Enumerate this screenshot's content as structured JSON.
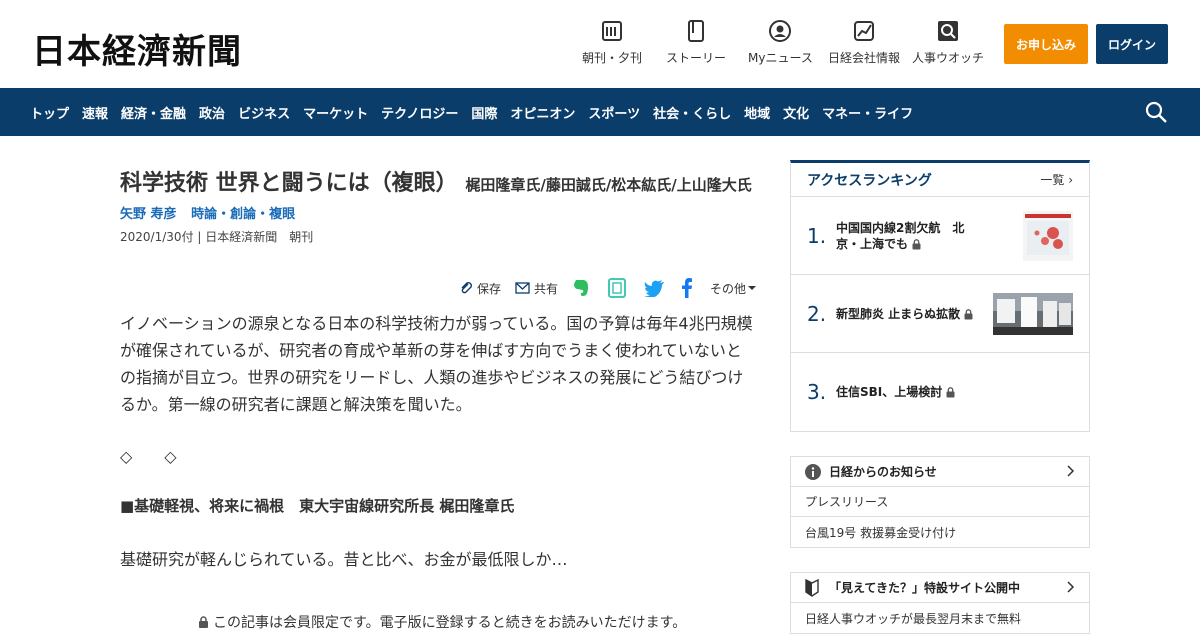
{
  "header": {
    "logo": "日本経濟新聞",
    "nav": [
      {
        "label": "朝刊・夕刊",
        "icon": "newspaper-icon"
      },
      {
        "label": "ストーリー",
        "icon": "book-icon"
      },
      {
        "label": "Myニュース",
        "icon": "user-icon"
      },
      {
        "label": "日経会社情報",
        "icon": "chart-icon"
      },
      {
        "label": "人事ウオッチ",
        "icon": "magnifier-icon"
      }
    ],
    "apply_label": "お申し込み",
    "login_label": "ログイン"
  },
  "navbar": {
    "items": [
      "トップ",
      "速報",
      "経済・金融",
      "政治",
      "ビジネス",
      "マーケット",
      "テクノロジー",
      "国際",
      "オピニオン",
      "スポーツ",
      "社会・くらし",
      "地域",
      "文化",
      "マネー・ライフ"
    ]
  },
  "article": {
    "title": "科学技術 世界と闘うには（複眼）",
    "title_names": "梶田隆章氏/藤田誠氏/松本紘氏/上山隆大氏",
    "author": "矢野 寿彦",
    "category": "時論・創論・複眼",
    "date": "2020/1/30付",
    "source": "日本経済新聞　朝刊",
    "tools": {
      "save": "保存",
      "share": "共有",
      "other": "その他"
    },
    "lead": "イノベーションの源泉となる日本の科学技術力が弱っている。国の予算は毎年4兆円規模が確保されているが、研究者の育成や革新の芽を伸ばす方向でうまく使われていないとの指摘が目立つ。世界の研究をリードし、人類の進歩やビジネスの発展にどう結びつけるか。第一線の研究者に課題と解決策を聞いた。",
    "diamonds": "◇　　◇",
    "subhead": "■基礎軽視、将来に禍根　東大宇宙線研究所長 梶田隆章氏",
    "body": "基礎研究が軽んじられている。昔と比べ、お金が最低限しか…",
    "member_note": "この記事は会員限定です。電子版に登録すると続きをお読みいただけます。"
  },
  "ranking": {
    "title": "アクセスランキング",
    "more": "一覧",
    "items": [
      {
        "num": "1.",
        "text": "中国国内線2割欠航　北京・上海でも"
      },
      {
        "num": "2.",
        "text": "新型肺炎 止まらぬ拡散"
      },
      {
        "num": "3.",
        "text": "住信SBI、上場検討"
      }
    ]
  },
  "notices": {
    "title": "日経からのお知らせ",
    "rows": [
      "プレスリリース",
      "台風19号 救援募金受け付け"
    ]
  },
  "special": {
    "title": "「見えてきた？」特設サイト公開中",
    "rows": [
      "日経人事ウオッチが最長翌月末まで無料"
    ]
  },
  "colors": {
    "brand": "#0b3d6b",
    "accent": "#f28c00",
    "link": "#1a6bb8"
  }
}
